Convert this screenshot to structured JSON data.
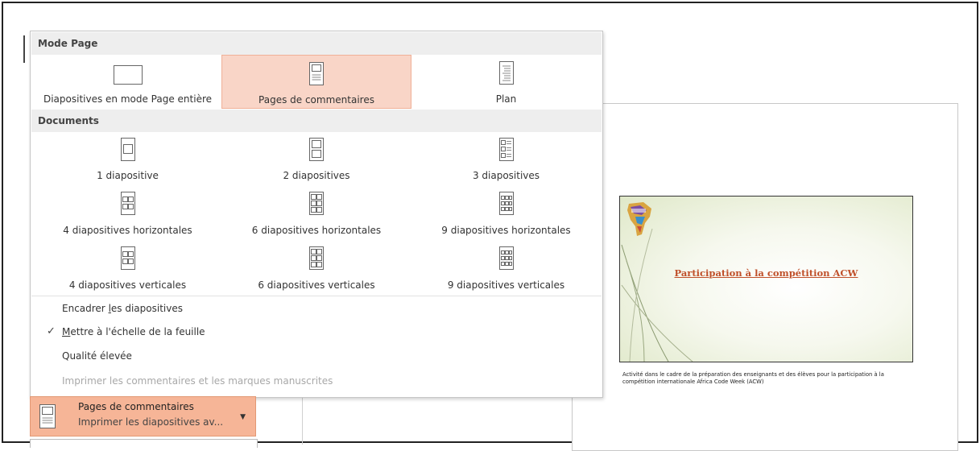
{
  "dropdown": {
    "mode_header": "Mode Page",
    "mode_options": [
      {
        "label": "Diapositives en mode Page entière",
        "icon": "full-page-slide-icon"
      },
      {
        "label": "Pages de commentaires",
        "icon": "notes-page-icon",
        "selected": true
      },
      {
        "label": "Plan",
        "icon": "outline-icon"
      }
    ],
    "docs_header": "Documents",
    "doc_options": [
      {
        "label": "1 diapositive"
      },
      {
        "label": "2 diapositives"
      },
      {
        "label": "3 diapositives"
      },
      {
        "label": "4 diapositives horizontales"
      },
      {
        "label": "6 diapositives horizontales"
      },
      {
        "label": "9 diapositives horizontales"
      },
      {
        "label": "4 diapositives verticales"
      },
      {
        "label": "6 diapositives verticales"
      },
      {
        "label": "9 diapositives verticales"
      }
    ],
    "menu_items": {
      "frame_prefix": "Encadrer ",
      "frame_ul": "l",
      "frame_suffix": "es diapositives",
      "scale_ul": "M",
      "scale_suffix": "ettre à l'échelle de la feuille",
      "scale_checked": "✓",
      "quality": "Qualité élevée",
      "print_comments": "Imprimer les commentaires et les marques manuscrites"
    }
  },
  "layout_button": {
    "title": "Pages de commentaires",
    "subtitle": "Imprimer les diapositives av...",
    "arrow": "▼"
  },
  "preview": {
    "slide_title": "Participation à la compétition ACW",
    "notes": "Activité dans le cadre de la préparation des enseignants et des élèves pour la participation à la compétition internationale Africa Code Week (ACW)"
  },
  "colors": {
    "selected_bg": "#f9d5c7",
    "button_bg": "#f6b597",
    "slide_title": "#c0502a"
  }
}
